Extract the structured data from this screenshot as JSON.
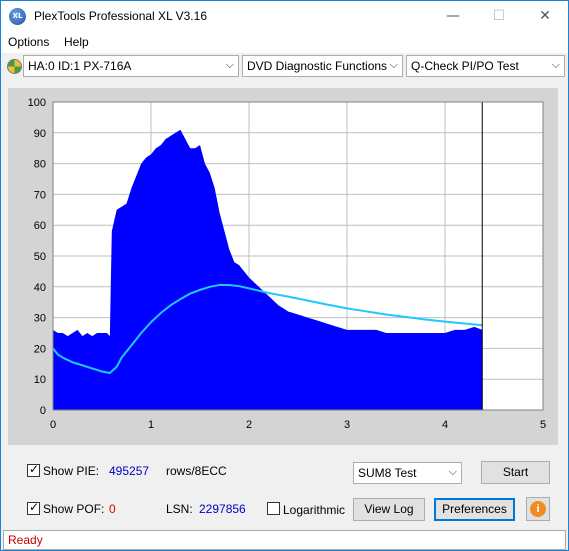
{
  "window": {
    "title": "PlexTools Professional XL V3.16",
    "icon_text": "XL"
  },
  "window_controls": {
    "minimize": "—",
    "maximize": "☐",
    "close": "✕"
  },
  "menu": {
    "options": "Options",
    "help": "Help"
  },
  "toolbar": {
    "drive": "HA:0 ID:1  PX-716A",
    "function": "DVD Diagnostic Functions",
    "test": "Q-Check PI/PO Test",
    "dropdown_arrow": "⌵"
  },
  "chart_data": {
    "type": "area",
    "xlim": [
      0,
      5
    ],
    "ylim": [
      0,
      100
    ],
    "x_ticks": [
      "0",
      "1",
      "2",
      "3",
      "4",
      "5"
    ],
    "y_ticks": [
      "0",
      "10",
      "20",
      "30",
      "40",
      "50",
      "60",
      "70",
      "80",
      "90",
      "100"
    ],
    "grid": true,
    "end_marker_x": 4.38,
    "colors": {
      "bars": "#0000ff",
      "curve": "#20c8ff",
      "plot_bg": "#ffffff",
      "frame_bg": "#d4d4d4"
    },
    "series": [
      {
        "type": "area",
        "x": [
          0,
          0.05,
          0.1,
          0.15,
          0.2,
          0.25,
          0.3,
          0.35,
          0.4,
          0.45,
          0.5,
          0.55,
          0.58,
          0.6,
          0.65,
          0.7,
          0.75,
          0.8,
          0.85,
          0.9,
          0.95,
          1.0,
          1.05,
          1.1,
          1.15,
          1.2,
          1.25,
          1.3,
          1.35,
          1.4,
          1.45,
          1.5,
          1.55,
          1.6,
          1.65,
          1.7,
          1.75,
          1.8,
          1.85,
          1.9,
          1.95,
          2.0,
          2.1,
          2.2,
          2.3,
          2.4,
          2.5,
          2.6,
          2.7,
          2.8,
          2.9,
          3.0,
          3.1,
          3.2,
          3.3,
          3.4,
          3.5,
          3.6,
          3.7,
          3.8,
          3.9,
          4.0,
          4.1,
          4.2,
          4.3,
          4.38
        ],
        "values": [
          26,
          25,
          25,
          24,
          25,
          26,
          24,
          25,
          24,
          25,
          25,
          25,
          24,
          58,
          65,
          66,
          67,
          72,
          76,
          80,
          82,
          83,
          85,
          86,
          88,
          89,
          90,
          91,
          88,
          85,
          85,
          86,
          80,
          77,
          72,
          64,
          58,
          52,
          48,
          47,
          45,
          43,
          40,
          37,
          34,
          32,
          31,
          30,
          29,
          28,
          27,
          26,
          26,
          26,
          26,
          25,
          25,
          25,
          25,
          25,
          25,
          25,
          26,
          26,
          27,
          26
        ]
      },
      {
        "type": "line",
        "x": [
          0,
          0.05,
          0.1,
          0.2,
          0.3,
          0.4,
          0.5,
          0.58,
          0.65,
          0.7,
          0.8,
          0.9,
          1.0,
          1.1,
          1.2,
          1.3,
          1.4,
          1.5,
          1.6,
          1.7,
          1.8,
          1.9,
          2.0,
          2.2,
          2.4,
          2.6,
          2.8,
          3.0,
          3.2,
          3.4,
          3.6,
          3.8,
          4.0,
          4.2,
          4.38
        ],
        "values": [
          20,
          18,
          17,
          15.5,
          14.5,
          13.5,
          12.5,
          12,
          14,
          17,
          21,
          25,
          28.5,
          31.5,
          34,
          36,
          37.8,
          39,
          40,
          40.6,
          40.6,
          40.2,
          39.5,
          38,
          36.8,
          35.5,
          34.2,
          33,
          32,
          31,
          30.2,
          29.4,
          28.7,
          28.1,
          27.5
        ]
      }
    ]
  },
  "controls": {
    "show_pie_label": "Show PIE:",
    "show_pie_value": "495257",
    "rows_label": "rows/8ECC",
    "show_pof_label": "Show POF:",
    "show_pof_value": "0",
    "lsn_label": "LSN:",
    "lsn_value": "2297856",
    "logarithmic_label": "Logarithmic",
    "check_mark": "✓",
    "sum_test": "SUM8 Test",
    "start_button": "Start",
    "view_log_button": "View Log",
    "preferences_button": "Preferences",
    "info_button": "i"
  },
  "status": {
    "text": "Ready"
  }
}
